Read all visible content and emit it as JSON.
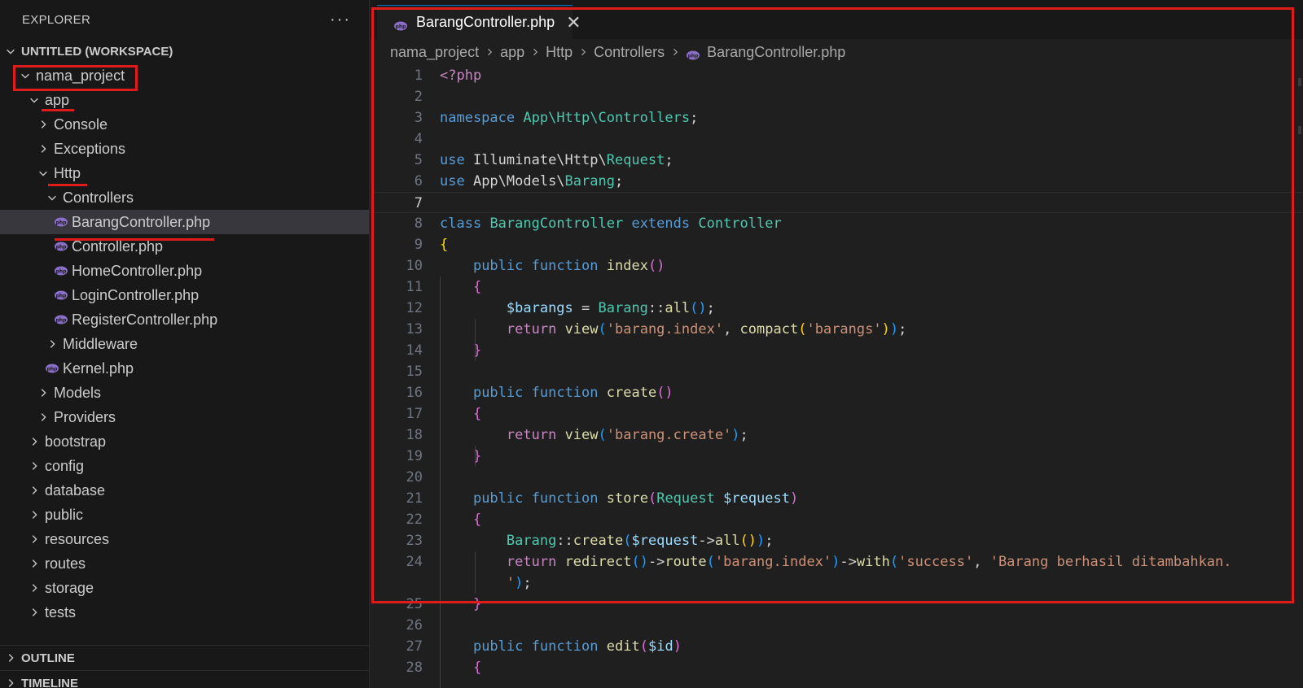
{
  "sidebar": {
    "title": "EXPLORER",
    "more": "···",
    "workspace": "UNTITLED (WORKSPACE)",
    "items": [
      {
        "label": "nama_project",
        "kind": "folder",
        "open": true
      },
      {
        "label": "app",
        "kind": "folder",
        "open": true
      },
      {
        "label": "Console",
        "kind": "folder",
        "open": false
      },
      {
        "label": "Exceptions",
        "kind": "folder",
        "open": false
      },
      {
        "label": "Http",
        "kind": "folder",
        "open": true
      },
      {
        "label": "Controllers",
        "kind": "folder",
        "open": true
      },
      {
        "label": "BarangController.php",
        "kind": "php",
        "selected": true
      },
      {
        "label": "Controller.php",
        "kind": "php"
      },
      {
        "label": "HomeController.php",
        "kind": "php"
      },
      {
        "label": "LoginController.php",
        "kind": "php"
      },
      {
        "label": "RegisterController.php",
        "kind": "php"
      },
      {
        "label": "Middleware",
        "kind": "folder",
        "open": false
      },
      {
        "label": "Kernel.php",
        "kind": "php"
      },
      {
        "label": "Models",
        "kind": "folder",
        "open": false
      },
      {
        "label": "Providers",
        "kind": "folder",
        "open": false
      },
      {
        "label": "bootstrap",
        "kind": "folder",
        "open": false
      },
      {
        "label": "config",
        "kind": "folder",
        "open": false
      },
      {
        "label": "database",
        "kind": "folder",
        "open": false
      },
      {
        "label": "public",
        "kind": "folder",
        "open": false
      },
      {
        "label": "resources",
        "kind": "folder",
        "open": false
      },
      {
        "label": "routes",
        "kind": "folder",
        "open": false
      },
      {
        "label": "storage",
        "kind": "folder",
        "open": false
      },
      {
        "label": "tests",
        "kind": "folder",
        "open": false
      }
    ],
    "outline": "OUTLINE",
    "timeline": "TIMELINE"
  },
  "editor": {
    "tab_label": "BarangController.php",
    "tab_close": "✕",
    "breadcrumb": [
      "nama_project",
      "app",
      "Http",
      "Controllers",
      "BarangController.php"
    ],
    "active_line": 7,
    "lines": [
      {
        "n": "1",
        "tokens": [
          [
            "t-ctl",
            "<?php"
          ]
        ]
      },
      {
        "n": "2",
        "tokens": []
      },
      {
        "n": "3",
        "tokens": [
          [
            "t-kw",
            "namespace"
          ],
          [
            "t-txt",
            " "
          ],
          [
            "t-cls",
            "App\\Http\\Controllers"
          ],
          [
            "t-txt",
            ";"
          ]
        ]
      },
      {
        "n": "4",
        "tokens": []
      },
      {
        "n": "5",
        "tokens": [
          [
            "t-kw",
            "use"
          ],
          [
            "t-txt",
            " Illuminate\\Http\\"
          ],
          [
            "t-cls",
            "Request"
          ],
          [
            "t-txt",
            ";"
          ]
        ]
      },
      {
        "n": "6",
        "tokens": [
          [
            "t-kw",
            "use"
          ],
          [
            "t-txt",
            " App\\Models\\"
          ],
          [
            "t-cls",
            "Barang"
          ],
          [
            "t-txt",
            ";"
          ]
        ]
      },
      {
        "n": "7",
        "tokens": []
      },
      {
        "n": "8",
        "tokens": [
          [
            "t-kw",
            "class"
          ],
          [
            "t-txt",
            " "
          ],
          [
            "t-cls",
            "BarangController"
          ],
          [
            "t-txt",
            " "
          ],
          [
            "t-kw",
            "extends"
          ],
          [
            "t-txt",
            " "
          ],
          [
            "t-cls",
            "Controller"
          ]
        ]
      },
      {
        "n": "9",
        "tokens": [
          [
            "t-b1",
            "{"
          ]
        ]
      },
      {
        "n": "10",
        "tokens": [
          [
            "t-txt",
            "    "
          ],
          [
            "t-kw",
            "public"
          ],
          [
            "t-txt",
            " "
          ],
          [
            "t-kw",
            "function"
          ],
          [
            "t-txt",
            " "
          ],
          [
            "t-fn",
            "index"
          ],
          [
            "t-b2",
            "()"
          ]
        ]
      },
      {
        "n": "11",
        "tokens": [
          [
            "t-txt",
            "    "
          ],
          [
            "t-b2",
            "{"
          ]
        ]
      },
      {
        "n": "12",
        "tokens": [
          [
            "t-txt",
            "        "
          ],
          [
            "t-var",
            "$barangs"
          ],
          [
            "t-txt",
            " = "
          ],
          [
            "t-cls",
            "Barang"
          ],
          [
            "t-txt",
            "::"
          ],
          [
            "t-fn",
            "all"
          ],
          [
            "t-b3",
            "()"
          ],
          [
            "t-txt",
            ";"
          ]
        ]
      },
      {
        "n": "13",
        "tokens": [
          [
            "t-txt",
            "        "
          ],
          [
            "t-ctl",
            "return"
          ],
          [
            "t-txt",
            " "
          ],
          [
            "t-fn",
            "view"
          ],
          [
            "t-b3",
            "("
          ],
          [
            "t-str",
            "'barang.index'"
          ],
          [
            "t-txt",
            ", "
          ],
          [
            "t-fn",
            "compact"
          ],
          [
            "t-b1",
            "("
          ],
          [
            "t-str",
            "'barangs'"
          ],
          [
            "t-b1",
            ")"
          ],
          [
            "t-b3",
            ")"
          ],
          [
            "t-txt",
            ";"
          ]
        ]
      },
      {
        "n": "14",
        "tokens": [
          [
            "t-txt",
            "    "
          ],
          [
            "t-b2",
            "}"
          ]
        ]
      },
      {
        "n": "15",
        "tokens": []
      },
      {
        "n": "16",
        "tokens": [
          [
            "t-txt",
            "    "
          ],
          [
            "t-kw",
            "public"
          ],
          [
            "t-txt",
            " "
          ],
          [
            "t-kw",
            "function"
          ],
          [
            "t-txt",
            " "
          ],
          [
            "t-fn",
            "create"
          ],
          [
            "t-b2",
            "()"
          ]
        ]
      },
      {
        "n": "17",
        "tokens": [
          [
            "t-txt",
            "    "
          ],
          [
            "t-b2",
            "{"
          ]
        ]
      },
      {
        "n": "18",
        "tokens": [
          [
            "t-txt",
            "        "
          ],
          [
            "t-ctl",
            "return"
          ],
          [
            "t-txt",
            " "
          ],
          [
            "t-fn",
            "view"
          ],
          [
            "t-b3",
            "("
          ],
          [
            "t-str",
            "'barang.create'"
          ],
          [
            "t-b3",
            ")"
          ],
          [
            "t-txt",
            ";"
          ]
        ]
      },
      {
        "n": "19",
        "tokens": [
          [
            "t-txt",
            "    "
          ],
          [
            "t-b2",
            "}"
          ]
        ]
      },
      {
        "n": "20",
        "tokens": []
      },
      {
        "n": "21",
        "tokens": [
          [
            "t-txt",
            "    "
          ],
          [
            "t-kw",
            "public"
          ],
          [
            "t-txt",
            " "
          ],
          [
            "t-kw",
            "function"
          ],
          [
            "t-txt",
            " "
          ],
          [
            "t-fn",
            "store"
          ],
          [
            "t-b2",
            "("
          ],
          [
            "t-cls",
            "Request"
          ],
          [
            "t-txt",
            " "
          ],
          [
            "t-var",
            "$request"
          ],
          [
            "t-b2",
            ")"
          ]
        ]
      },
      {
        "n": "22",
        "tokens": [
          [
            "t-txt",
            "    "
          ],
          [
            "t-b2",
            "{"
          ]
        ]
      },
      {
        "n": "23",
        "tokens": [
          [
            "t-txt",
            "        "
          ],
          [
            "t-cls",
            "Barang"
          ],
          [
            "t-txt",
            "::"
          ],
          [
            "t-fn",
            "create"
          ],
          [
            "t-b3",
            "("
          ],
          [
            "t-var",
            "$request"
          ],
          [
            "t-txt",
            "->"
          ],
          [
            "t-fn",
            "all"
          ],
          [
            "t-b1",
            "()"
          ],
          [
            "t-b3",
            ")"
          ],
          [
            "t-txt",
            ";"
          ]
        ]
      },
      {
        "n": "24",
        "tokens": [
          [
            "t-txt",
            "        "
          ],
          [
            "t-ctl",
            "return"
          ],
          [
            "t-txt",
            " "
          ],
          [
            "t-fn",
            "redirect"
          ],
          [
            "t-b3",
            "()"
          ],
          [
            "t-txt",
            "->"
          ],
          [
            "t-fn",
            "route"
          ],
          [
            "t-b3",
            "("
          ],
          [
            "t-str",
            "'barang.index'"
          ],
          [
            "t-b3",
            ")"
          ],
          [
            "t-txt",
            "->"
          ],
          [
            "t-fn",
            "with"
          ],
          [
            "t-b3",
            "("
          ],
          [
            "t-str",
            "'success'"
          ],
          [
            "t-txt",
            ", "
          ],
          [
            "t-str",
            "'Barang berhasil ditambahkan."
          ]
        ]
      },
      {
        "n": "",
        "tokens": [
          [
            "t-txt",
            "        "
          ],
          [
            "t-str",
            "'"
          ],
          [
            "t-b3",
            ")"
          ],
          [
            "t-txt",
            ";"
          ]
        ]
      },
      {
        "n": "25",
        "tokens": [
          [
            "t-txt",
            "    "
          ],
          [
            "t-b2",
            "}"
          ]
        ]
      },
      {
        "n": "26",
        "tokens": []
      },
      {
        "n": "27",
        "tokens": [
          [
            "t-txt",
            "    "
          ],
          [
            "t-kw",
            "public"
          ],
          [
            "t-txt",
            " "
          ],
          [
            "t-kw",
            "function"
          ],
          [
            "t-txt",
            " "
          ],
          [
            "t-fn",
            "edit"
          ],
          [
            "t-b2",
            "("
          ],
          [
            "t-var",
            "$id"
          ],
          [
            "t-b2",
            ")"
          ]
        ]
      },
      {
        "n": "28",
        "tokens": [
          [
            "t-txt",
            "    "
          ],
          [
            "t-b2",
            "{"
          ]
        ]
      }
    ]
  },
  "colors": {
    "annotation_red": "#e01b1b",
    "php_icon": "#8a6fc9",
    "selected_row": "#37373d"
  }
}
